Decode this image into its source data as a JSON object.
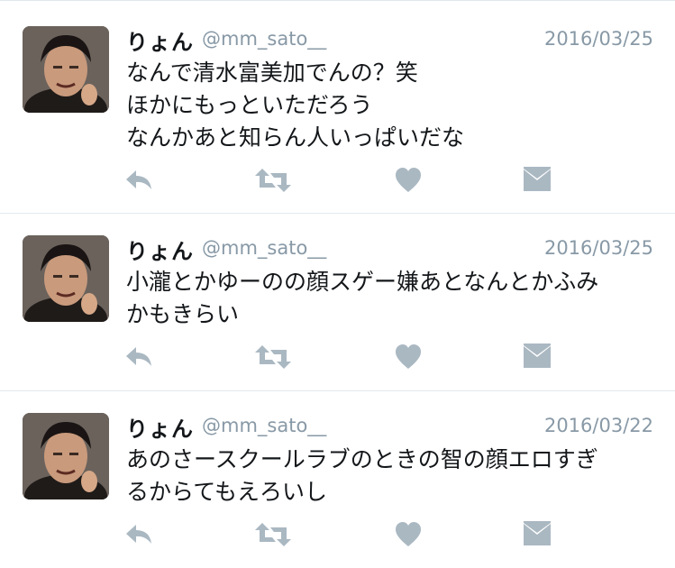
{
  "tweets": [
    {
      "name": "りょん",
      "handle": "@mm_sato__",
      "date": "2016/03/25",
      "text": "なんで清水富美加でんの？笑\nほかにもっといただろう\nなんかあと知らん人いっぱいだな"
    },
    {
      "name": "りょん",
      "handle": "@mm_sato__",
      "date": "2016/03/25",
      "text": "小瀧とかゆーのの顔スゲー嫌あとなんとかふみ\nかもきらい"
    },
    {
      "name": "りょん",
      "handle": "@mm_sato__",
      "date": "2016/03/22",
      "text": "あのさースクールラブのときの智の顔エロすぎ\nるからてもえろいし"
    }
  ],
  "action_icons": [
    "reply-icon",
    "retweet-icon",
    "like-icon",
    "dm-icon"
  ],
  "colors": {
    "icon": "#aab8c2",
    "meta": "#8899a6",
    "divider": "#e1e8ed"
  }
}
